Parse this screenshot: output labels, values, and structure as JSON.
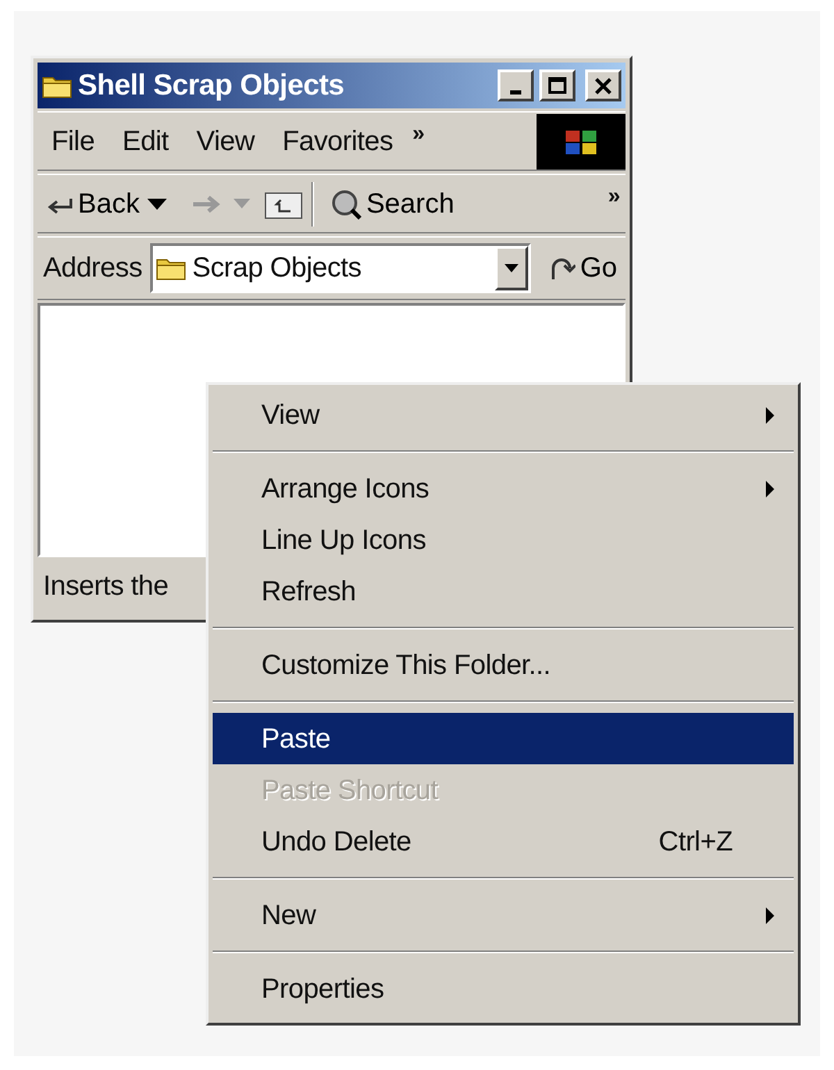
{
  "window": {
    "title": "Shell Scrap Objects"
  },
  "menu_bar": {
    "items": [
      {
        "label": "File"
      },
      {
        "label": "Edit"
      },
      {
        "label": "View"
      },
      {
        "label": "Favorites"
      }
    ],
    "overflow": "»"
  },
  "toolbar": {
    "back": "Back",
    "search": "Search",
    "overflow": "»"
  },
  "address_bar": {
    "label": "Address",
    "value": "Scrap Objects",
    "go": "Go"
  },
  "status_bar": {
    "text": "Inserts the"
  },
  "context_menu": {
    "items": [
      {
        "kind": "item",
        "label": "View",
        "submenu": true,
        "disabled": false,
        "selected": false
      },
      {
        "kind": "separator"
      },
      {
        "kind": "item",
        "label": "Arrange Icons",
        "submenu": true,
        "disabled": false,
        "selected": false
      },
      {
        "kind": "item",
        "label": "Line Up Icons",
        "submenu": false,
        "disabled": false,
        "selected": false
      },
      {
        "kind": "item",
        "label": "Refresh",
        "submenu": false,
        "disabled": false,
        "selected": false
      },
      {
        "kind": "separator"
      },
      {
        "kind": "item",
        "label": "Customize This Folder...",
        "submenu": false,
        "disabled": false,
        "selected": false
      },
      {
        "kind": "separator"
      },
      {
        "kind": "item",
        "label": "Paste",
        "submenu": false,
        "disabled": false,
        "selected": true
      },
      {
        "kind": "item",
        "label": "Paste Shortcut",
        "submenu": false,
        "disabled": true,
        "selected": false
      },
      {
        "kind": "item",
        "label": "Undo Delete",
        "shortcut": "Ctrl+Z",
        "submenu": false,
        "disabled": false,
        "selected": false
      },
      {
        "kind": "separator"
      },
      {
        "kind": "item",
        "label": "New",
        "submenu": true,
        "disabled": false,
        "selected": false
      },
      {
        "kind": "separator"
      },
      {
        "kind": "item",
        "label": "Properties",
        "submenu": false,
        "disabled": false,
        "selected": false
      }
    ]
  }
}
